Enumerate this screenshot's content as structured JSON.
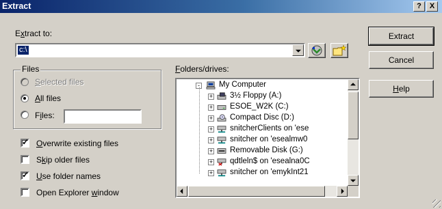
{
  "window": {
    "title": "Extract",
    "help_glyph": "?",
    "close_glyph": "X"
  },
  "extract_to": {
    "label_pre": "E",
    "label_u": "x",
    "label_post": "tract to:",
    "value": "c:\\"
  },
  "buttons": {
    "extract": "Extract",
    "cancel": "Cancel",
    "help_u": "H",
    "help_rest": "elp"
  },
  "files_group": {
    "title": "Files",
    "options": [
      {
        "u": "S",
        "rest": "elected files",
        "selected": false,
        "disabled": true
      },
      {
        "u": "A",
        "rest": "ll files",
        "selected": true,
        "disabled": false
      },
      {
        "pre": "F",
        "u": "i",
        "rest": "les:",
        "selected": false,
        "disabled": false
      }
    ],
    "files_value": ""
  },
  "options": [
    {
      "u": "O",
      "rest": "verwrite existing files",
      "checked": true
    },
    {
      "pre": "S",
      "u": "k",
      "rest": "ip older files",
      "checked": false
    },
    {
      "u": "U",
      "rest": "se folder names",
      "checked": true
    },
    {
      "pre": "Open Explorer ",
      "u": "w",
      "rest": "indow",
      "checked": false
    }
  ],
  "folders": {
    "label_u": "F",
    "label_rest": "olders/drives:",
    "items": [
      {
        "label": "My Computer",
        "icon": "computer-icon",
        "level": 0,
        "expander": "-"
      },
      {
        "label": "3½ Floppy (A:)",
        "icon": "floppy-drive-icon",
        "level": 1,
        "expander": "+"
      },
      {
        "label": "ESOE_W2K (C:)",
        "icon": "hard-drive-icon",
        "level": 1,
        "expander": "+"
      },
      {
        "label": "Compact Disc (D:)",
        "icon": "cd-drive-icon",
        "level": 1,
        "expander": "+"
      },
      {
        "label": "snitcherClients on 'ese",
        "icon": "network-drive-icon",
        "level": 1,
        "expander": "+"
      },
      {
        "label": "snitcher on 'esealmw0",
        "icon": "network-drive-icon",
        "level": 1,
        "expander": "+"
      },
      {
        "label": "Removable Disk (G:)",
        "icon": "removable-disk-icon",
        "level": 1,
        "expander": "+"
      },
      {
        "label": "qdtleln$ on 'esealna0C",
        "icon": "disconnected-network-drive-icon",
        "level": 1,
        "expander": "+"
      },
      {
        "label": "snitcher on 'emykInt21",
        "icon": "network-drive-icon",
        "level": 1,
        "expander": "+"
      }
    ]
  },
  "colors": {
    "title_active": "#0a246a",
    "face": "#d4d0c8",
    "selection": "#0a246a"
  }
}
